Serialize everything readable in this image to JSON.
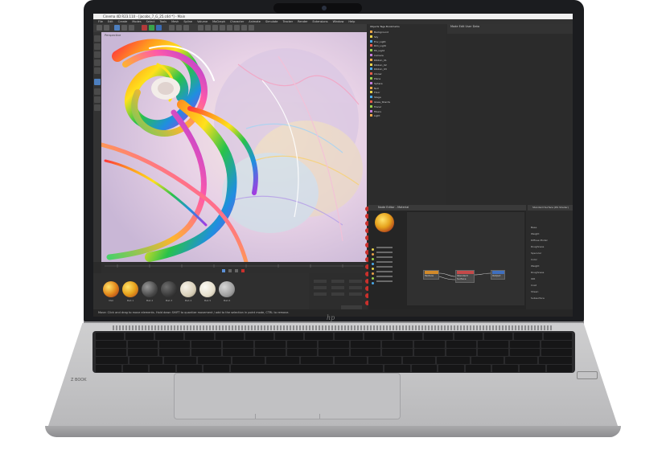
{
  "device": {
    "brand_logo": "hp",
    "colors": {
      "bezel": "#1b1c1f",
      "chassis": "#c4c4c6",
      "keyboard": "#161617",
      "accent_red": "#c9302c"
    }
  },
  "app": {
    "window_title": "Cinema 4D R23.110 - [jacobs_7_G_25.c4d *] - Main",
    "menu": [
      "File",
      "Edit",
      "Create",
      "Modes",
      "Select",
      "Tools",
      "Mesh",
      "Spline",
      "Volume",
      "MoGraph",
      "Character",
      "Animate",
      "Simulate",
      "Tracker",
      "Render",
      "Extensions",
      "Window",
      "Help"
    ],
    "viewport_label": "Perspective",
    "object_manager_header": "Objects  Tags  Bookmarks",
    "objects": [
      "Background",
      "Sky",
      "Env_Light",
      "Rim_Light",
      "Fill_Light",
      "Camera",
      "Ribbon_01",
      "Ribbon_02",
      "Ribbon_03",
      "Cloner",
      "Plane",
      "Sphere",
      "Null",
      "Floor",
      "Stage",
      "Glass_Shards",
      "Tracer",
      "Fibers",
      "Light"
    ],
    "attributes_header": "Mode  Edit  User Data",
    "node_editor_title": "Node Editor - Material",
    "node_editor_header": "Node Editor",
    "nodes": [
      "Texture",
      "Color Correction",
      "Standard Surface",
      "Output"
    ],
    "node_attributes_title": "Standard Surface (RS Shader)",
    "node_attributes": [
      "Base",
      "Weight",
      "Diffuse Model",
      "Roughness",
      "Specular",
      "Color",
      "Weight",
      "Roughness",
      "IOR",
      "Coat",
      "Sheen",
      "Subsurface"
    ],
    "materials": [
      "Mat",
      "Mat.1",
      "Mat.2",
      "Mat.3",
      "Mat.4",
      "Mat.5",
      "Mat.6"
    ],
    "status_text": "Move: Click and drag to move elements. Hold down SHIFT to quantize movement / add to the selection in point mode, CTRL to remove."
  },
  "keyboard": {
    "deck_label": "Z BOOK"
  }
}
